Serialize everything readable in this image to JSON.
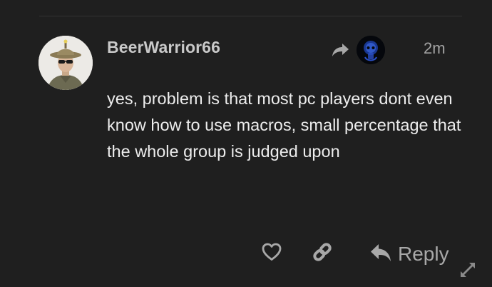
{
  "post": {
    "username": "BeerWarrior66",
    "date": "2m",
    "content": "yes, problem is that most pc players dont even know how to use macros, small percentage that the whole group is judged upon"
  },
  "actions": {
    "reply_label": "Reply"
  },
  "icons": {
    "reply_to": "share-arrow-icon",
    "like": "heart-icon",
    "link": "link-icon",
    "reply": "reply-arrow-icon",
    "expand": "expand-arrows-icon"
  },
  "colors": {
    "background": "#1f1f1f",
    "text": "#ededed",
    "muted": "#a8a8a8"
  }
}
